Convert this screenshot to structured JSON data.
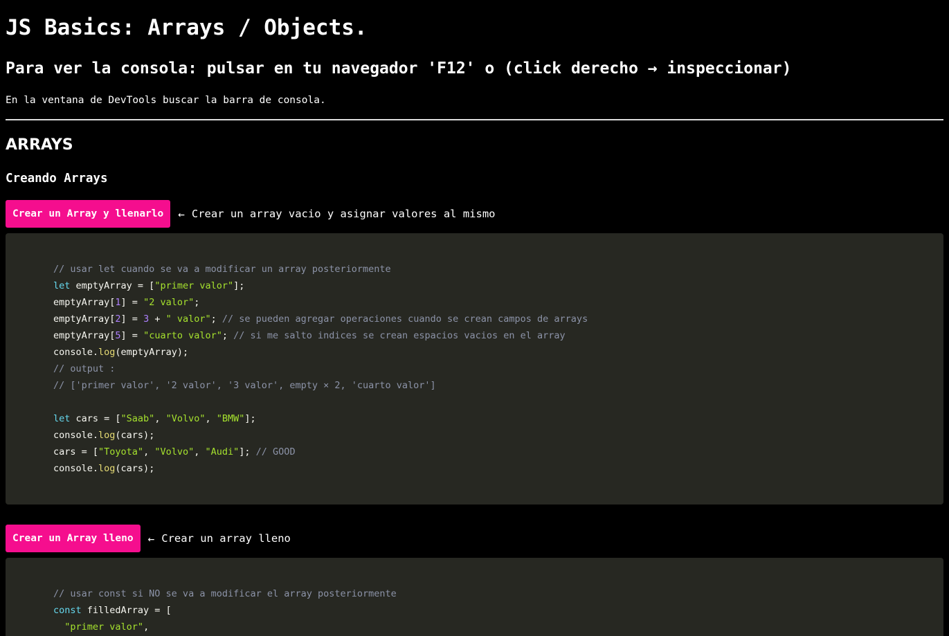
{
  "header": {
    "title": "JS Basics: Arrays / Objects.",
    "subtitle": "Para ver la consola: pulsar en tu navegador 'F12' o (click derecho → inspeccionar)",
    "intro": "En la ventana de DevTools buscar la barra de consola."
  },
  "section": {
    "title": "ARRAYS",
    "subtitle": "Creando Arrays"
  },
  "arrow_glyph": "←",
  "examples": [
    {
      "button_label": "Crear un Array y llenarlo",
      "description": "Crear un array vacio y asignar valores al mismo",
      "code_lines": [
        [
          {
            "t": "// usar let cuando se va a modificar un array posteriormente",
            "c": "comment"
          }
        ],
        [
          {
            "t": "let",
            "c": "keyword"
          },
          {
            "t": " emptyArray = [",
            "c": "plain"
          },
          {
            "t": "\"primer valor\"",
            "c": "string"
          },
          {
            "t": "];",
            "c": "plain"
          }
        ],
        [
          {
            "t": "emptyArray[",
            "c": "plain"
          },
          {
            "t": "1",
            "c": "number"
          },
          {
            "t": "] = ",
            "c": "plain"
          },
          {
            "t": "\"2 valor\"",
            "c": "string"
          },
          {
            "t": ";",
            "c": "plain"
          }
        ],
        [
          {
            "t": "emptyArray[",
            "c": "plain"
          },
          {
            "t": "2",
            "c": "number"
          },
          {
            "t": "] = ",
            "c": "plain"
          },
          {
            "t": "3",
            "c": "number"
          },
          {
            "t": " + ",
            "c": "plain"
          },
          {
            "t": "\" valor\"",
            "c": "string"
          },
          {
            "t": "; ",
            "c": "plain"
          },
          {
            "t": "// se pueden agregar operaciones cuando se crean campos de arrays",
            "c": "comment"
          }
        ],
        [
          {
            "t": "emptyArray[",
            "c": "plain"
          },
          {
            "t": "5",
            "c": "number"
          },
          {
            "t": "] = ",
            "c": "plain"
          },
          {
            "t": "\"cuarto valor\"",
            "c": "string"
          },
          {
            "t": "; ",
            "c": "plain"
          },
          {
            "t": "// si me salto indices se crean espacios vacios en el array",
            "c": "comment"
          }
        ],
        [
          {
            "t": "console.",
            "c": "plain"
          },
          {
            "t": "log",
            "c": "fn"
          },
          {
            "t": "(emptyArray);",
            "c": "plain"
          }
        ],
        [
          {
            "t": "// output :",
            "c": "comment"
          }
        ],
        [
          {
            "t": "// ['primer valor', '2 valor', '3 valor', empty × 2, 'cuarto valor']",
            "c": "comment"
          }
        ],
        [],
        [
          {
            "t": "let",
            "c": "keyword"
          },
          {
            "t": " cars = [",
            "c": "plain"
          },
          {
            "t": "\"Saab\"",
            "c": "string"
          },
          {
            "t": ", ",
            "c": "plain"
          },
          {
            "t": "\"Volvo\"",
            "c": "string"
          },
          {
            "t": ", ",
            "c": "plain"
          },
          {
            "t": "\"BMW\"",
            "c": "string"
          },
          {
            "t": "];",
            "c": "plain"
          }
        ],
        [
          {
            "t": "console.",
            "c": "plain"
          },
          {
            "t": "log",
            "c": "fn"
          },
          {
            "t": "(cars);",
            "c": "plain"
          }
        ],
        [
          {
            "t": "cars = [",
            "c": "plain"
          },
          {
            "t": "\"Toyota\"",
            "c": "string"
          },
          {
            "t": ", ",
            "c": "plain"
          },
          {
            "t": "\"Volvo\"",
            "c": "string"
          },
          {
            "t": ", ",
            "c": "plain"
          },
          {
            "t": "\"Audi\"",
            "c": "string"
          },
          {
            "t": "]; ",
            "c": "plain"
          },
          {
            "t": "// GOOD",
            "c": "comment"
          }
        ],
        [
          {
            "t": "console.",
            "c": "plain"
          },
          {
            "t": "log",
            "c": "fn"
          },
          {
            "t": "(cars);",
            "c": "plain"
          }
        ]
      ]
    },
    {
      "button_label": "Crear un Array lleno",
      "description": "Crear un array lleno",
      "code_lines": [
        [
          {
            "t": "// usar const si NO se va a modificar el array posteriormente",
            "c": "comment"
          }
        ],
        [
          {
            "t": "const",
            "c": "keyword"
          },
          {
            "t": " filledArray = [",
            "c": "plain"
          }
        ],
        [
          {
            "t": "  ",
            "c": "plain"
          },
          {
            "t": "\"primer valor\"",
            "c": "string"
          },
          {
            "t": ",",
            "c": "plain"
          }
        ]
      ]
    }
  ],
  "colors": {
    "background": "#000000",
    "accent_button": "#f50e8e",
    "code_background": "#272822",
    "comment": "#8c93a8",
    "keyword": "#66d9ef",
    "string": "#a6e22e",
    "number": "#ae81ff",
    "function": "#e6db74"
  }
}
